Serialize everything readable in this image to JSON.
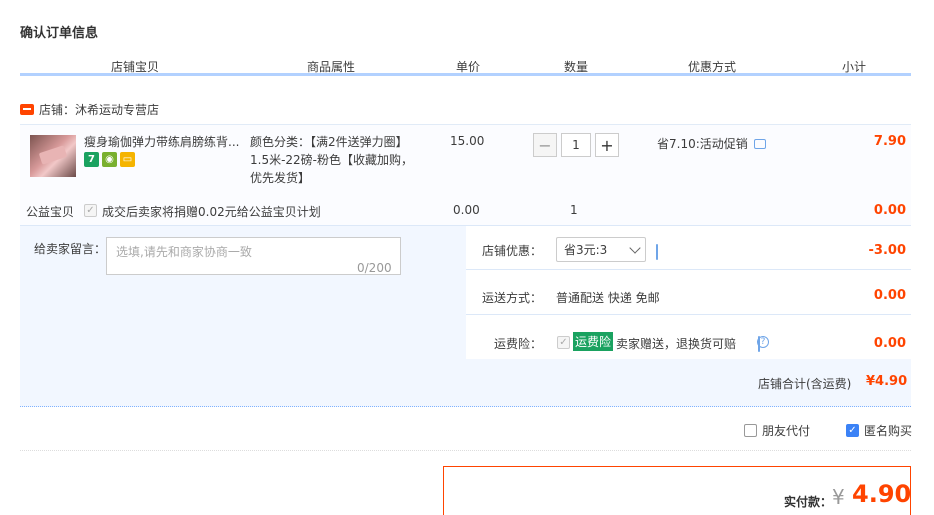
{
  "page_title": "确认订单信息",
  "table_headers": [
    "店铺宝贝",
    "商品属性",
    "单价",
    "数量",
    "优惠方式",
    "小计"
  ],
  "shop": {
    "label": "店铺：沐希运动专营店"
  },
  "item": {
    "name": "瘦身瑜伽弹力带练肩膀练背...",
    "icons": [
      "7-day-return-icon",
      "tmall-guarantee-icon",
      "credit-card-icon"
    ],
    "attributes": "颜色分类：【满2件送弹力圈】1.5米-22磅-粉色【收藏加购，优先发货】",
    "price": "15.00",
    "quantity": "1",
    "promotion": "省7.10:活动促销",
    "subtotal": "7.90"
  },
  "charity": {
    "label": "公益宝贝",
    "text": "成交后卖家将捐赠0.02元给公益宝贝计划",
    "price": "0.00",
    "quantity": "1",
    "subtotal": "0.00"
  },
  "message": {
    "label": "给卖家留言：",
    "placeholder": "选填,请先和商家协商一致",
    "count": "0/200"
  },
  "shop_discount": {
    "label": "店铺优惠：",
    "selected": "省3元:3",
    "amount": "-3.00"
  },
  "shipping": {
    "label": "运送方式：",
    "value": "普通配送 快递 免邮",
    "amount": "0.00"
  },
  "insurance": {
    "label": "运费险：",
    "tag": "运费险",
    "text": "卖家赠送，退换货可赔",
    "amount": "0.00"
  },
  "shop_total": {
    "label": "店铺合计(含运费)",
    "value": "¥4.90"
  },
  "options": {
    "friend_pay": "朋友代付",
    "anonymous": "匿名购买"
  },
  "payment": {
    "label": "实付款：",
    "currency": "¥",
    "value": "4.90"
  },
  "colors": {
    "accent": "#ff4400",
    "header_border": "#b2d1ff",
    "panel_bg": "#f2f7ff"
  }
}
